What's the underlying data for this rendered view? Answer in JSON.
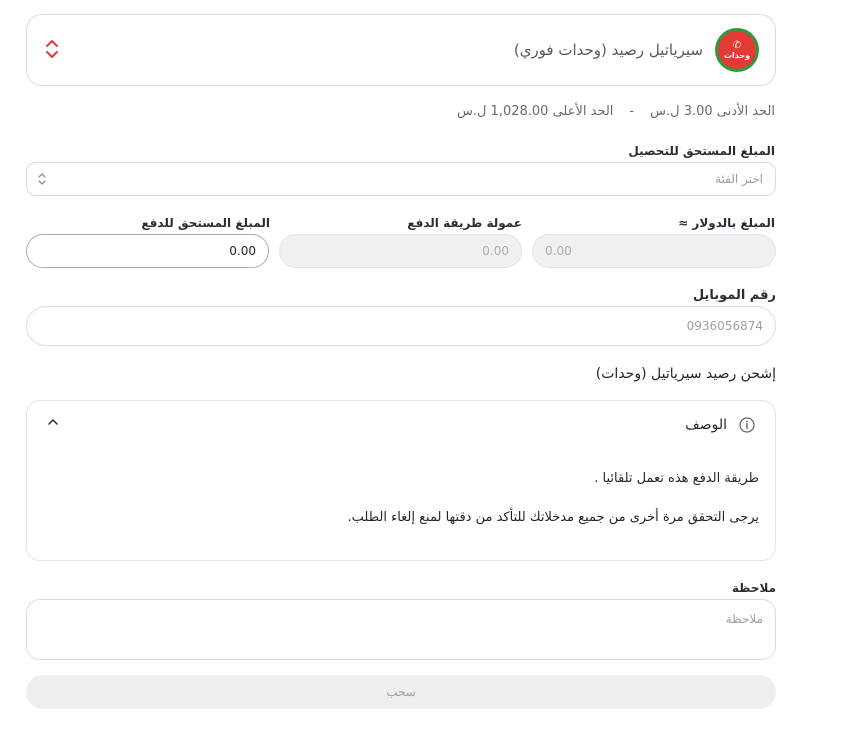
{
  "service": {
    "name": "سيرياتيل رصيد (وحدات فوري)",
    "logo_text_top": "سيرياتيل",
    "logo_text_bottom": "وحدات"
  },
  "limits": {
    "min": "الحد الأدنى 3.00 ل.س",
    "separator": "-",
    "max": "الحد الأعلى 1,028.00 ل.س"
  },
  "amount_due": {
    "label": "المبلغ المستحق للتحصيل",
    "placeholder": "اختر الفئة"
  },
  "usd_amount": {
    "label": "المبلغ بالدولار ≈",
    "value": "0.00"
  },
  "payment_fee": {
    "label": "عمولة طريقة الدفع",
    "value": "0.00"
  },
  "payable_amount": {
    "label": "المبلغ المستحق للدفع",
    "value": "0.00"
  },
  "mobile": {
    "label": "رقم الموبايل",
    "placeholder": "0936056874"
  },
  "section_title": "إشحن رصيد سيرياتيل (وحدات)",
  "description": {
    "header": "الوصف",
    "line1": "طريقة الدفع هذه تعمل تلقائيا .",
    "line2": "يرجى التحقق مرة أخرى من جميع مدخلاتك للتأكد من دقتها لمنع إلغاء الطلب."
  },
  "note": {
    "label": "ملاحظة",
    "placeholder": "ملاحظة"
  },
  "submit_label": "سحب",
  "colors": {
    "accent_red": "#e53935",
    "logo_green": "#2f9a3b"
  }
}
